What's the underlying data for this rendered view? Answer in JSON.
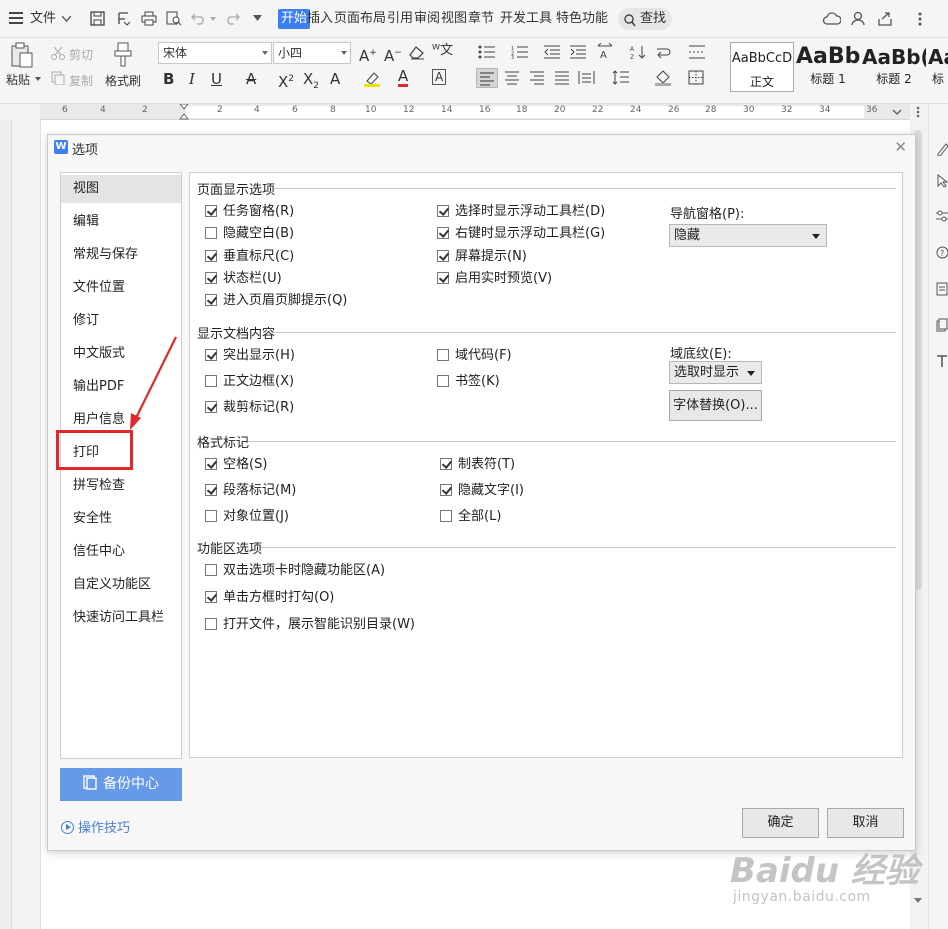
{
  "menubar": {
    "file": "文件",
    "tabs": [
      "开始",
      "插入",
      "页面布局",
      "引用",
      "审阅",
      "视图",
      "章节",
      "开发工具",
      "特色功能"
    ],
    "search": "查找"
  },
  "ribbon": {
    "paste": "粘贴",
    "cut": "剪切",
    "copy": "复制",
    "format_painter": "格式刷",
    "font_name": "宋体",
    "font_size": "小四",
    "styles": [
      {
        "sample": "AaBbCcD",
        "name": "正文"
      },
      {
        "sample": "AaBb",
        "name": "标题 1"
      },
      {
        "sample": "AaBb(",
        "name": "标题 2"
      },
      {
        "sample": "Aa",
        "name": "标"
      }
    ]
  },
  "ruler": [
    "6",
    "4",
    "2",
    "2",
    "4",
    "6",
    "8",
    "10",
    "12",
    "14",
    "16",
    "18",
    "20",
    "22",
    "24",
    "26",
    "28",
    "30",
    "32",
    "34",
    "36"
  ],
  "dialog": {
    "title": "选项",
    "nav": [
      "视图",
      "编辑",
      "常规与保存",
      "文件位置",
      "修订",
      "中文版式",
      "输出PDF",
      "用户信息",
      "打印",
      "拼写检查",
      "安全性",
      "信任中心",
      "自定义功能区",
      "快速访问工具栏"
    ],
    "backup": "备份中心",
    "tips": "操作技巧",
    "ok": "确定",
    "cancel": "取消",
    "sections": {
      "page_display": "页面显示选项",
      "doc_content": "显示文档内容",
      "format_marks": "格式标记",
      "ribbon_options": "功能区选项"
    },
    "page_display_opts": [
      {
        "label": "任务窗格(R)",
        "checked": true
      },
      {
        "label": "隐藏空白(B)",
        "checked": false
      },
      {
        "label": "垂直标尺(C)",
        "checked": true
      },
      {
        "label": "状态栏(U)",
        "checked": true
      },
      {
        "label": "进入页眉页脚提示(Q)",
        "checked": true
      },
      {
        "label": "选择时显示浮动工具栏(D)",
        "checked": true
      },
      {
        "label": "右键时显示浮动工具栏(G)",
        "checked": true
      },
      {
        "label": "屏幕提示(N)",
        "checked": true
      },
      {
        "label": "启用实时预览(V)",
        "checked": true
      }
    ],
    "nav_pane": {
      "label": "导航窗格(P):",
      "value": "隐藏"
    },
    "doc_content_opts": [
      {
        "label": "突出显示(H)",
        "checked": true
      },
      {
        "label": "正文边框(X)",
        "checked": false
      },
      {
        "label": "裁剪标记(R)",
        "checked": true
      },
      {
        "label": "域代码(F)",
        "checked": false
      },
      {
        "label": "书签(K)",
        "checked": false
      }
    ],
    "field_shading": {
      "label": "域底纹(E):",
      "value": "选取时显示"
    },
    "font_replace": "字体替换(O)...",
    "format_marks_opts": [
      {
        "label": "空格(S)",
        "checked": true
      },
      {
        "label": "段落标记(M)",
        "checked": true
      },
      {
        "label": "对象位置(J)",
        "checked": false
      },
      {
        "label": "制表符(T)",
        "checked": true
      },
      {
        "label": "隐藏文字(I)",
        "checked": true
      },
      {
        "label": "全部(L)",
        "checked": false
      }
    ],
    "ribbon_opts": [
      {
        "label": "双击选项卡时隐藏功能区(A)",
        "checked": false
      },
      {
        "label": "单击方框时打勾(O)",
        "checked": true
      },
      {
        "label": "打开文件，展示智能识别目录(W)",
        "checked": false
      }
    ]
  },
  "watermark": {
    "brand": "Baidu 经验",
    "url": "jingyan.baidu.com"
  },
  "colors": {
    "accent": "#3c7ef4",
    "highlight_red": "#e02828",
    "backup_button": "#6699e8"
  }
}
